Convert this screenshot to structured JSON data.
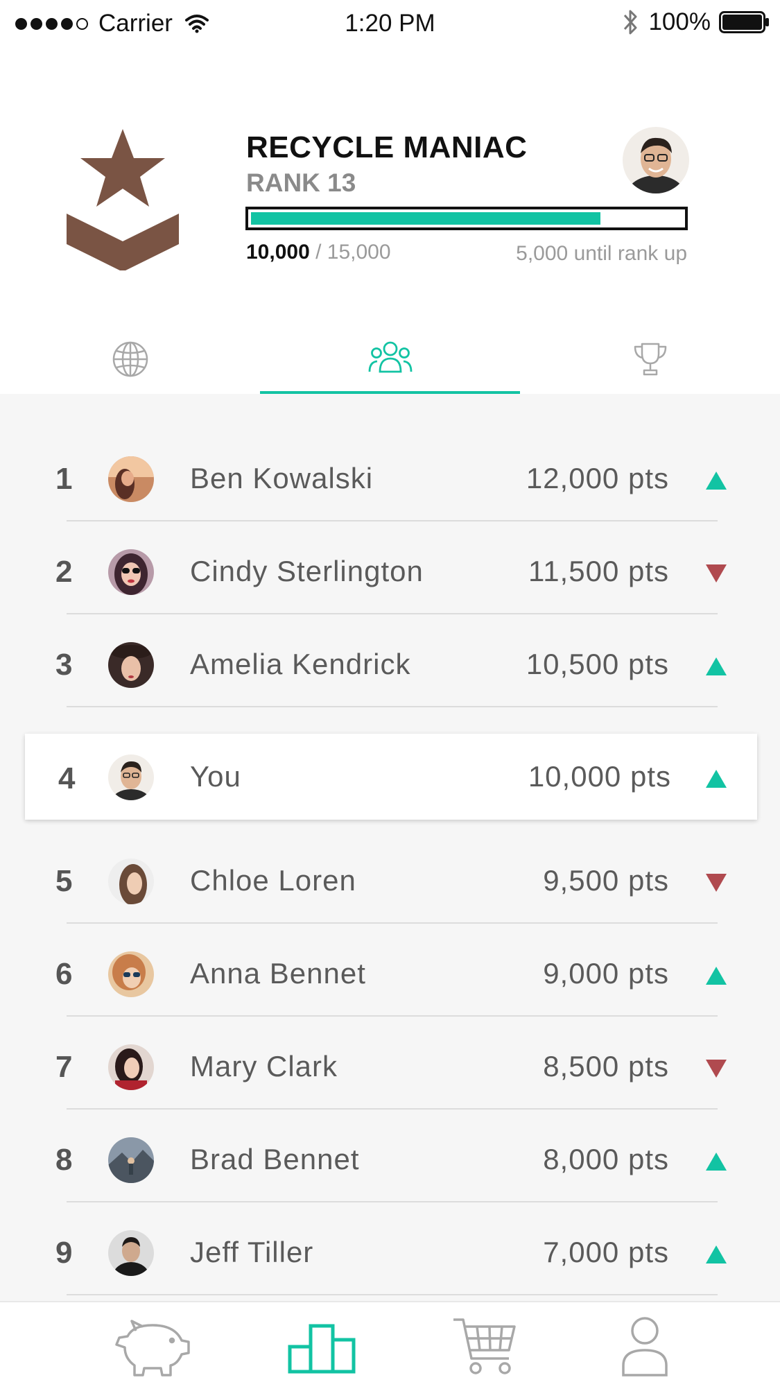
{
  "status_bar": {
    "carrier": "Carrier",
    "time": "1:20 PM",
    "battery": "100%"
  },
  "profile": {
    "title": "RECYCLE MANIAC",
    "rank_label": "RANK 13",
    "points_current": "10,000",
    "points_max": "/ 15,000",
    "until_rank_up": "5,000 until rank up",
    "progress": 0.81,
    "badge_color": "#7a5444"
  },
  "tabs": [
    {
      "icon": "globe-icon",
      "active": false
    },
    {
      "icon": "friends-icon",
      "active": true
    },
    {
      "icon": "trophy-icon",
      "active": false
    }
  ],
  "leaderboard": [
    {
      "rank": "1",
      "name": "Ben Kowalski",
      "points": "12,000 pts",
      "trend": "up"
    },
    {
      "rank": "2",
      "name": "Cindy Sterlington",
      "points": "11,500 pts",
      "trend": "down"
    },
    {
      "rank": "3",
      "name": "Amelia Kendrick",
      "points": "10,500 pts",
      "trend": "up"
    },
    {
      "rank": "4",
      "name": "You",
      "points": "10,000 pts",
      "trend": "up",
      "highlight": true
    },
    {
      "rank": "5",
      "name": "Chloe Loren",
      "points": "9,500 pts",
      "trend": "down"
    },
    {
      "rank": "6",
      "name": "Anna Bennet",
      "points": "9,000 pts",
      "trend": "up"
    },
    {
      "rank": "7",
      "name": "Mary Clark",
      "points": "8,500 pts",
      "trend": "down"
    },
    {
      "rank": "8",
      "name": "Brad Bennet",
      "points": "8,000 pts",
      "trend": "up"
    },
    {
      "rank": "9",
      "name": "Jeff Tiller",
      "points": "7,000 pts",
      "trend": "up"
    }
  ],
  "bottom_nav": [
    {
      "icon": "piggy-bank-icon",
      "active": false
    },
    {
      "icon": "leaderboard-icon",
      "active": true
    },
    {
      "icon": "cart-icon",
      "active": false
    },
    {
      "icon": "profile-icon",
      "active": false
    }
  ],
  "colors": {
    "accent": "#12c3a3",
    "trend_up": "#12c3a3",
    "trend_down": "#b04a4f",
    "inactive_icon": "#a8a8a8"
  }
}
